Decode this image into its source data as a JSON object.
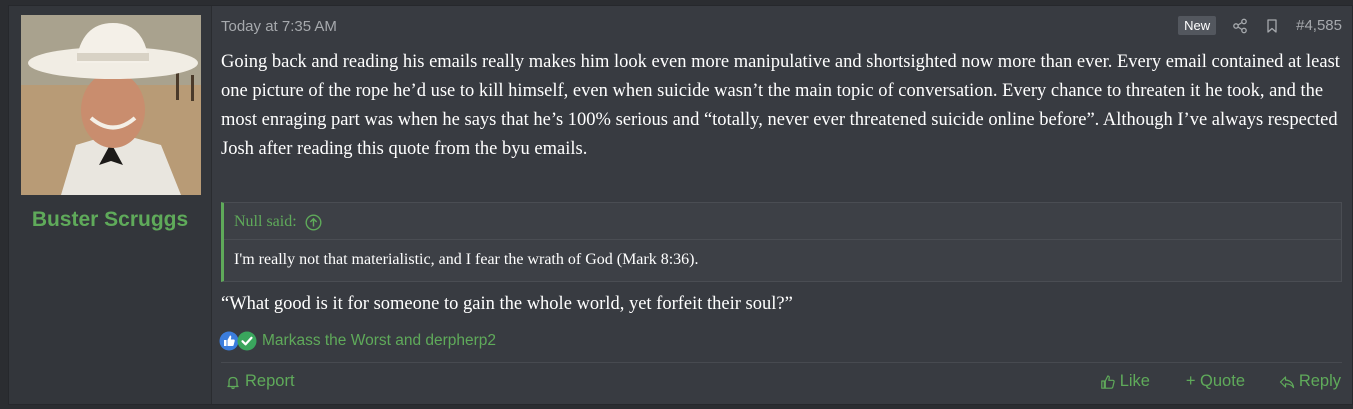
{
  "post": {
    "author": "Buster Scruggs",
    "date": "Today at 7:35 AM",
    "badge_new": "New",
    "post_number": "#4,585",
    "message": "Going back and reading his emails really makes him look even more manipulative and shortsighted now more than ever. Every email contained at least one picture of the rope he’d use to kill himself, even when suicide wasn’t the main topic of conversation. Every chance to threaten it he took, and the most enraging part was when he says that he’s 100% serious and “totally, never ever threatened suicide online before”. Although I’ve always respected Josh after reading this quote from the byu emails.",
    "quote": {
      "title": "Null said:",
      "body": "I'm really not that materialistic, and I fear the wrath of God (Mark 8:36)."
    },
    "message_after": "“What good is it for someone to gain the whole world, yet forfeit their soul?”",
    "reactions": {
      "icons": [
        "like-reaction-icon",
        "check-reaction-icon"
      ],
      "names": "Markass the Worst and derpherp2"
    },
    "actions": {
      "report": "Report",
      "like": "Like",
      "quote": "+ Quote",
      "reply": "Reply"
    }
  },
  "colors": {
    "accent": "#5faa5a",
    "background": "#383b41",
    "user_cell": "#33363b",
    "muted_text": "#a6a9ad"
  }
}
